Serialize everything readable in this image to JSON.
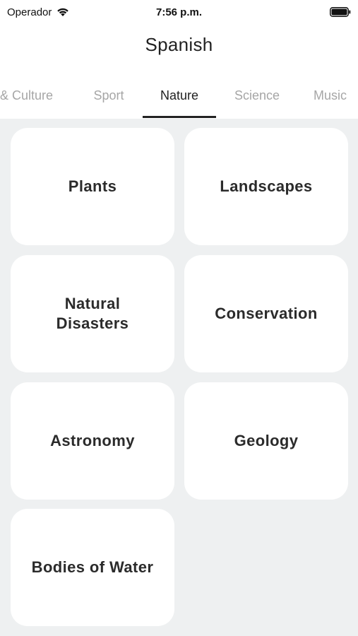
{
  "status": {
    "carrier": "Operador",
    "time": "7:56 p.m."
  },
  "header": {
    "title": "Spanish"
  },
  "tabs": [
    {
      "label": "& Culture",
      "active": false
    },
    {
      "label": "Sport",
      "active": false
    },
    {
      "label": "Nature",
      "active": true
    },
    {
      "label": "Science",
      "active": false
    },
    {
      "label": "Music",
      "active": false
    }
  ],
  "topics": [
    {
      "label": "Plants"
    },
    {
      "label": "Landscapes"
    },
    {
      "label": "Natural Disasters"
    },
    {
      "label": "Conservation"
    },
    {
      "label": "Astronomy"
    },
    {
      "label": "Geology"
    },
    {
      "label": "Bodies of Water"
    }
  ]
}
